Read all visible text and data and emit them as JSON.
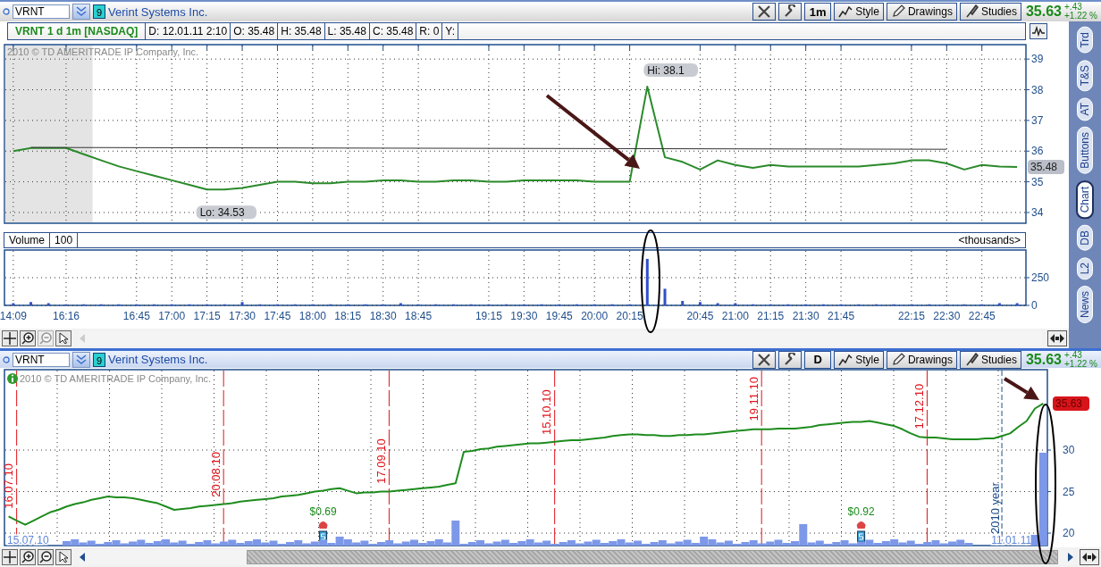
{
  "top_chart": {
    "header": {
      "symbol": "VRNT",
      "link_group": "9",
      "company": "Verint Systems Inc.",
      "aggregation": "1m",
      "buttons": [
        "Style",
        "Drawings",
        "Studies"
      ],
      "last": "35.63",
      "change": "+.43",
      "change_pct": "+1.22 %"
    },
    "info": {
      "title": "VRNT 1 d 1m [NASDAQ]",
      "fields": [
        "D: 12.01.11 2:10",
        "O: 35.48",
        "H: 35.48",
        "L: 35.48",
        "C: 35.48",
        "R: 0",
        "Y:"
      ]
    },
    "copyright": "2010 © TD AMERITRADE IP Company, Inc.",
    "price_chart": {
      "high_label": "Hi: 38.1",
      "low_label": "Lo: 34.53",
      "last_tag": "35.48",
      "chart_data": {
        "type": "line",
        "grid": true,
        "ylim": [
          33.65,
          39.47
        ],
        "yticks": [
          34,
          35,
          36,
          37,
          38,
          39
        ],
        "categories": [
          null,
          null,
          null,
          null,
          null,
          null,
          null,
          null,
          null,
          null,
          null,
          null,
          null,
          null,
          null,
          null,
          null,
          null,
          null,
          null,
          null,
          null,
          null,
          null,
          null,
          null,
          null,
          null,
          null,
          null,
          null,
          null,
          null,
          null,
          null,
          null,
          null,
          null,
          null,
          null,
          null,
          null,
          null,
          null,
          null,
          null,
          null,
          null,
          null,
          null,
          null,
          null,
          null,
          null,
          null,
          null,
          null,
          null
        ],
        "series": [
          {
            "color": "#2b8a2b",
            "values": [
              36.0,
              36.1,
              36.1,
              36.1,
              35.9,
              35.7,
              35.5,
              35.35,
              35.2,
              35.05,
              34.9,
              34.75,
              34.75,
              34.8,
              34.9,
              35.0,
              35.0,
              34.95,
              34.95,
              35.0,
              35.0,
              35.05,
              35.05,
              35.0,
              35.0,
              35.05,
              35.05,
              35.0,
              35.0,
              35.05,
              35.05,
              35.05,
              35.05,
              35.0,
              35.0,
              35.0,
              38.1,
              35.8,
              35.65,
              35.4,
              35.7,
              35.55,
              35.45,
              35.55,
              35.5,
              35.5,
              35.5,
              35.5,
              35.5,
              35.55,
              35.6,
              35.7,
              35.7,
              35.6,
              35.4,
              35.55,
              35.5,
              35.48
            ]
          }
        ]
      }
    },
    "volume": {
      "label": "Volume",
      "value": "100",
      "units": "<thousands>",
      "chart_data": {
        "type": "bar",
        "grid": true,
        "ylim": [
          0,
          500
        ],
        "yticks": [
          0,
          250
        ],
        "categories": [
          "14:09",
          null,
          null,
          "16:16",
          null,
          null,
          null,
          "16:45",
          null,
          "17:00",
          null,
          "17:15",
          null,
          "17:30",
          null,
          "17:45",
          null,
          "18:00",
          null,
          "18:15",
          null,
          "18:30",
          null,
          "18:45",
          null,
          null,
          null,
          "19:15",
          null,
          "19:30",
          null,
          "19:45",
          null,
          "20:00",
          null,
          "20:15",
          null,
          null,
          null,
          "20:45",
          null,
          "21:00",
          null,
          "21:15",
          null,
          "21:30",
          null,
          "21:45",
          null,
          null,
          null,
          "22:15",
          null,
          "22:30",
          null,
          "22:45",
          null,
          null
        ],
        "series": [
          {
            "color": "#3050c8",
            "values": [
              20,
              30,
              20,
              10,
              10,
              10,
              10,
              10,
              10,
              10,
              10,
              10,
              10,
              30,
              10,
              10,
              10,
              10,
              10,
              10,
              10,
              10,
              20,
              10,
              10,
              10,
              10,
              10,
              10,
              10,
              10,
              10,
              10,
              10,
              10,
              10,
              420,
              150,
              40,
              30,
              20,
              20,
              10,
              10,
              10,
              10,
              10,
              10,
              10,
              10,
              10,
              10,
              10,
              10,
              10,
              10,
              20,
              20
            ]
          }
        ]
      }
    },
    "toolbar": {
      "zoom_out_disabled": true
    }
  },
  "side_tabs": [
    {
      "label": "Trd",
      "selected": false
    },
    {
      "label": "T&S",
      "selected": false
    },
    {
      "label": "AT",
      "selected": false
    },
    {
      "label": "Buttons",
      "selected": false
    },
    {
      "label": "Chart",
      "selected": true
    },
    {
      "label": "DB",
      "selected": false
    },
    {
      "label": "L2",
      "selected": false
    },
    {
      "label": "News",
      "selected": false
    }
  ],
  "bottom_chart": {
    "header": {
      "symbol": "VRNT",
      "link_group": "9",
      "company": "Verint Systems Inc.",
      "aggregation": "D",
      "buttons": [
        "Style",
        "Drawings",
        "Studies"
      ],
      "last": "35.63",
      "change": "+.43",
      "change_pct": "+1.22 %"
    },
    "copyright": "2010 © TD AMERITRADE IP Company, Inc.",
    "start_date": "15.07.10",
    "end_date": "11.01.11",
    "year_marker": "2010 year",
    "last_tag": "35.63",
    "dividends": [
      {
        "amount": "$0.69"
      },
      {
        "amount": "$0.92"
      }
    ],
    "chart_data": {
      "type": "line",
      "grid": true,
      "ylim": [
        18.5,
        39.68
      ],
      "yticks": [
        20,
        25,
        30
      ],
      "categories": [
        "16.07.10",
        null,
        null,
        null,
        null,
        null,
        null,
        null,
        null,
        null,
        null,
        null,
        null,
        null,
        null,
        null,
        null,
        null,
        null,
        null,
        null,
        null,
        null,
        null,
        null,
        "20.08.10",
        null,
        null,
        null,
        null,
        null,
        null,
        null,
        null,
        null,
        null,
        null,
        null,
        null,
        null,
        null,
        null,
        null,
        null,
        null,
        "17.09.10",
        null,
        null,
        null,
        null,
        null,
        null,
        null,
        null,
        null,
        null,
        null,
        null,
        null,
        null,
        null,
        null,
        null,
        null,
        null,
        "15.10.10",
        null,
        null,
        null,
        null,
        null,
        null,
        null,
        null,
        null,
        null,
        null,
        null,
        null,
        null,
        null,
        null,
        null,
        null,
        null,
        null,
        null,
        null,
        null,
        null,
        "19.11.10",
        null,
        null,
        null,
        null,
        null,
        null,
        null,
        null,
        null,
        null,
        null,
        null,
        null,
        null,
        null,
        null,
        null,
        null,
        null,
        "17.12.10",
        null,
        null,
        null,
        null,
        null,
        null,
        null,
        null,
        null,
        null,
        null,
        null,
        null,
        null,
        null
      ],
      "series": [
        {
          "color": "#1e8c1e",
          "values": [
            22.0,
            21.5,
            21.0,
            21.5,
            22.0,
            22.5,
            22.8,
            23.2,
            23.5,
            23.7,
            24.0,
            24.2,
            24.4,
            24.3,
            24.3,
            24.2,
            24.0,
            23.8,
            23.6,
            23.2,
            22.8,
            22.9,
            23.0,
            23.2,
            23.3,
            23.4,
            23.5,
            23.6,
            23.8,
            23.9,
            24.0,
            24.1,
            24.2,
            24.4,
            24.5,
            24.6,
            24.8,
            25.0,
            25.1,
            25.3,
            25.4,
            25.1,
            24.8,
            24.9,
            24.9,
            25.0,
            25.0,
            25.1,
            25.2,
            25.3,
            25.4,
            25.5,
            25.6,
            25.8,
            26.0,
            29.8,
            29.9,
            30.1,
            30.2,
            30.4,
            30.5,
            30.6,
            30.7,
            30.8,
            30.8,
            30.9,
            31.0,
            31.1,
            31.2,
            31.2,
            31.3,
            31.4,
            31.5,
            31.7,
            31.8,
            31.9,
            31.9,
            31.8,
            31.8,
            31.7,
            31.7,
            31.8,
            31.8,
            31.9,
            31.9,
            32.0,
            32.1,
            32.2,
            32.3,
            32.4,
            32.5,
            32.5,
            32.5,
            32.6,
            32.6,
            32.6,
            32.7,
            32.8,
            33.0,
            33.1,
            33.2,
            33.3,
            33.4,
            33.4,
            33.5,
            33.3,
            33.1,
            32.9,
            32.5,
            32.0,
            31.6,
            31.5,
            31.5,
            31.4,
            31.3,
            31.3,
            31.3,
            31.3,
            31.4,
            31.4,
            31.7,
            32.0,
            32.8,
            33.5,
            35.0,
            35.6
          ]
        }
      ]
    },
    "toolbar": {
      "zoom_out_disabled": false
    }
  }
}
